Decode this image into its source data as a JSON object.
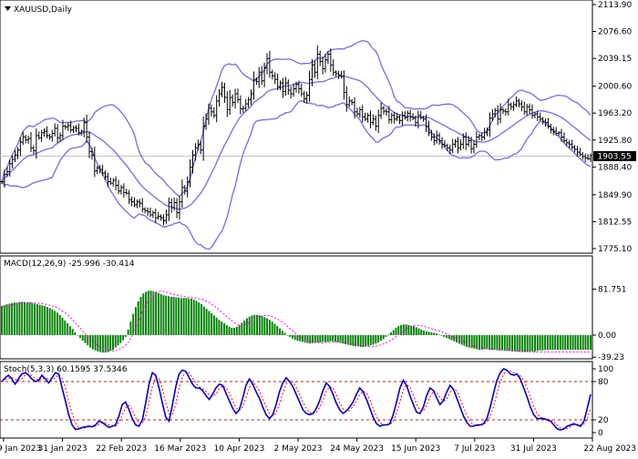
{
  "chart_data": {
    "type": "line",
    "title": "XAUUSD,Daily",
    "colors": {
      "candle": "#000000",
      "bollinger": "#7b68ee",
      "macd_hist": "#008000",
      "signal": "#ff00ff",
      "stoch_main": "#0000cd",
      "stoch_signal": "#ff0000",
      "level_line": "#b22222",
      "price_line": "#c0c0c0",
      "price_label_bg": "#000000"
    },
    "x_axis": {
      "tick_labels": [
        "9 Jan 2023",
        "31 Jan 2023",
        "22 Feb 2023",
        "16 Mar 2023",
        "10 Apr 2023",
        "2 May 2023",
        "24 May 2023",
        "15 Jun 2023",
        "7 Jul 2023",
        "31 Jul 2023",
        "22 Aug 2023"
      ]
    },
    "price_panel": {
      "ylim": [
        1760,
        2125
      ],
      "y_ticks": [
        "2113.90",
        "2076.60",
        "2039.15",
        "2000.60",
        "1963.20",
        "1925.80",
        "1888.40",
        "1849.90",
        "1812.55",
        "1775.10"
      ],
      "current_price": "1903.55",
      "close": [
        1868,
        1878,
        1882,
        1893,
        1899,
        1905,
        1912,
        1923,
        1930,
        1926,
        1928,
        1915,
        1911,
        1932,
        1929,
        1936,
        1938,
        1932,
        1930,
        1935,
        1942,
        1929,
        1932,
        1945,
        1944,
        1946,
        1940,
        1943,
        1942,
        1936,
        1938,
        1950,
        1930,
        1910,
        1905,
        1883,
        1887,
        1885,
        1880,
        1875,
        1868,
        1866,
        1870,
        1863,
        1855,
        1860,
        1853,
        1852,
        1843,
        1840,
        1836,
        1840,
        1838,
        1830,
        1828,
        1826,
        1822,
        1825,
        1818,
        1820,
        1818,
        1814,
        1822,
        1839,
        1832,
        1839,
        1825,
        1840,
        1860,
        1855,
        1868,
        1888,
        1905,
        1915,
        1920,
        1912,
        1945,
        1955,
        1970,
        1965,
        1960,
        1980,
        1990,
        1999,
        1985,
        1968,
        1985,
        1978,
        1990,
        1982,
        1969,
        1970,
        1976,
        1982,
        1990,
        2010,
        2007,
        2020,
        2008,
        2026,
        2039,
        2020,
        2015,
        2010,
        2000,
        2005,
        1993,
        2005,
        1995,
        1990,
        1997,
        2003,
        1997,
        1990,
        1983,
        1988,
        2010,
        2030,
        2020,
        2045,
        2035,
        2025,
        2037,
        2045,
        2030,
        2020,
        2018,
        2016,
        2014,
        1992,
        1975,
        1980,
        1978,
        1965,
        1962,
        1968,
        1958,
        1955,
        1960,
        1950,
        1955,
        1945,
        1960,
        1970,
        1966,
        1965,
        1954,
        1960,
        1955,
        1958,
        1953,
        1960,
        1957,
        1963,
        1958,
        1956,
        1950,
        1960,
        1957,
        1955,
        1945,
        1936,
        1930,
        1925,
        1932,
        1925,
        1920,
        1918,
        1915,
        1912,
        1920,
        1924,
        1915,
        1920,
        1930,
        1920,
        1925,
        1914,
        1920,
        1930,
        1932,
        1930,
        1936,
        1940,
        1956,
        1962,
        1967,
        1955,
        1968,
        1966,
        1965,
        1975,
        1972,
        1975,
        1980,
        1976,
        1972,
        1965,
        1972,
        1968,
        1960,
        1962,
        1958,
        1955,
        1952,
        1950,
        1945,
        1940,
        1938,
        1935,
        1936,
        1930,
        1925,
        1922,
        1920,
        1916,
        1913,
        1909,
        1906,
        1903,
        1901,
        1900,
        1904
      ]
    },
    "macd_panel": {
      "title": "MACD(12,26,9) -25.996 -30.414",
      "ylim": [
        -45,
        90
      ],
      "y_ticks": [
        "81.751",
        "0.00",
        "-39.23"
      ],
      "hist": [
        52,
        53,
        55,
        56,
        57,
        58,
        58,
        59,
        59,
        59,
        58,
        58,
        57,
        56,
        55,
        54,
        53,
        52,
        50,
        48,
        46,
        43,
        40,
        36,
        31,
        26,
        21,
        16,
        11,
        5,
        0,
        -5,
        -10,
        -14,
        -18,
        -22,
        -25,
        -27,
        -29,
        -30,
        -31,
        -31,
        -30,
        -28,
        -26,
        -22,
        -18,
        -14,
        -9,
        -3,
        10,
        24,
        38,
        50,
        60,
        68,
        74,
        77,
        79,
        79,
        78,
        77,
        75,
        73,
        71,
        70,
        69,
        68,
        68,
        67,
        67,
        66,
        66,
        66,
        65,
        65,
        63,
        61,
        58,
        55,
        51,
        47,
        43,
        39,
        35,
        31,
        27,
        24,
        21,
        18,
        15,
        13,
        13,
        15,
        18,
        22,
        26,
        30,
        33,
        35,
        36,
        36,
        35,
        34,
        32,
        30,
        27,
        24,
        20,
        16,
        12,
        8,
        4,
        0,
        -3,
        -6,
        -8,
        -10,
        -11,
        -12,
        -13,
        -14,
        -15,
        -14,
        -14,
        -13,
        -13,
        -12,
        -12,
        -12,
        -11,
        -11,
        -12,
        -13,
        -14,
        -15,
        -16,
        -17,
        -18,
        -19,
        -20,
        -20,
        -21,
        -21,
        -20,
        -19,
        -18,
        -17,
        -15,
        -13,
        -10,
        -7,
        -3,
        1,
        5,
        9,
        13,
        16,
        18,
        19,
        19,
        18,
        17,
        16,
        14,
        12,
        10,
        8,
        7,
        6,
        5,
        4,
        3,
        1,
        -1,
        -3,
        -5,
        -7,
        -9,
        -11,
        -13,
        -15,
        -17,
        -19,
        -21,
        -22,
        -23,
        -24,
        -25,
        -26,
        -26,
        -25,
        -25,
        -26,
        -26,
        -26,
        -27,
        -27,
        -27,
        -28,
        -28,
        -28,
        -29,
        -29,
        -29,
        -30,
        -30,
        -30,
        -30,
        -30,
        -29,
        -29,
        -28,
        -27,
        -27,
        -26,
        -26,
        -26,
        -26,
        -26,
        -26,
        -26,
        -26,
        -26,
        -26,
        -26,
        -26,
        -26,
        -26,
        -26,
        -26,
        -26,
        -26,
        -26
      ],
      "signal": [
        50,
        51,
        52,
        53,
        54,
        55,
        56,
        57,
        57,
        58,
        58,
        58,
        58,
        57,
        57,
        56,
        56,
        55,
        54,
        53,
        51,
        50,
        48,
        45,
        42,
        39,
        35,
        31,
        26,
        21,
        16,
        11,
        6,
        1,
        -4,
        -8,
        -12,
        -16,
        -19,
        -22,
        -24,
        -26,
        -27,
        -28,
        -28,
        -27,
        -25,
        -23,
        -20,
        -16,
        -10,
        -2,
        7,
        18,
        29,
        40,
        50,
        59,
        66,
        71,
        75,
        77,
        78,
        78,
        77,
        76,
        74,
        73,
        72,
        71,
        70,
        69,
        68,
        67,
        67,
        66,
        66,
        65,
        64,
        63,
        61,
        59,
        56,
        53,
        50,
        46,
        42,
        38,
        34,
        30,
        26,
        23,
        20,
        18,
        17,
        18,
        20,
        22,
        25,
        28,
        31,
        33,
        34,
        35,
        35,
        34,
        33,
        31,
        29,
        26,
        23,
        20,
        16,
        12,
        8,
        4,
        0,
        -3,
        -6,
        -8,
        -10,
        -11,
        -12,
        -13,
        -13,
        -14,
        -14,
        -13,
        -13,
        -13,
        -12,
        -12,
        -12,
        -12,
        -13,
        -13,
        -14,
        -15,
        -16,
        -17,
        -18,
        -19,
        -19,
        -20,
        -20,
        -20,
        -20,
        -19,
        -18,
        -17,
        -15,
        -13,
        -11,
        -8,
        -5,
        -1,
        2,
        6,
        9,
        12,
        14,
        16,
        17,
        17,
        17,
        16,
        15,
        14,
        12,
        11,
        9,
        8,
        7,
        5,
        3,
        1,
        -1,
        -3,
        -5,
        -7,
        -9,
        -11,
        -13,
        -15,
        -17,
        -19,
        -20,
        -21,
        -22,
        -23,
        -24,
        -24,
        -25,
        -25,
        -25,
        -26,
        -26,
        -26,
        -27,
        -27,
        -27,
        -28,
        -28,
        -28,
        -29,
        -29,
        -29,
        -29,
        -30,
        -30,
        -30,
        -30,
        -30,
        -30,
        -30,
        -30,
        -30,
        -30,
        -30,
        -30,
        -30,
        -30,
        -30,
        -30,
        -30,
        -30,
        -30,
        -30,
        -30,
        -30,
        -30,
        -30
      ]
    },
    "stoch_panel": {
      "title": "Stoch(5,3,3) 60.1595 37.5346",
      "ylim": [
        0,
        100
      ],
      "y_ticks": [
        "100",
        "80",
        "20",
        "0"
      ],
      "levels": [
        80,
        20
      ],
      "main": [
        80,
        86,
        90,
        84,
        76,
        85,
        92,
        94,
        90,
        84,
        80,
        82,
        90,
        84,
        78,
        86,
        94,
        92,
        70,
        50,
        28,
        12,
        5,
        6,
        8,
        9,
        10,
        9,
        12,
        18,
        16,
        12,
        8,
        10,
        12,
        26,
        44,
        48,
        36,
        22,
        12,
        10,
        20,
        46,
        76,
        94,
        90,
        70,
        46,
        24,
        18,
        44,
        72,
        92,
        98,
        96,
        86,
        76,
        70,
        70,
        66,
        58,
        52,
        60,
        70,
        76,
        74,
        62,
        50,
        38,
        30,
        36,
        54,
        74,
        84,
        76,
        64,
        54,
        40,
        28,
        22,
        28,
        44,
        64,
        78,
        86,
        80,
        72,
        60,
        48,
        36,
        30,
        28,
        30,
        38,
        50,
        66,
        78,
        72,
        60,
        46,
        36,
        30,
        34,
        40,
        48,
        60,
        70,
        64,
        52,
        38,
        24,
        14,
        10,
        12,
        12,
        14,
        28,
        48,
        70,
        82,
        74,
        58,
        44,
        32,
        30,
        40,
        58,
        70,
        66,
        54,
        44,
        50,
        64,
        74,
        68,
        54,
        40,
        26,
        16,
        10,
        10,
        12,
        12,
        14,
        22,
        40,
        62,
        82,
        94,
        100,
        98,
        92,
        90,
        92,
        84,
        70,
        56,
        40,
        28,
        22,
        22,
        22,
        20,
        18,
        12,
        6,
        4,
        6,
        10,
        12,
        14,
        12,
        10,
        18,
        38,
        60
      ]
    }
  }
}
